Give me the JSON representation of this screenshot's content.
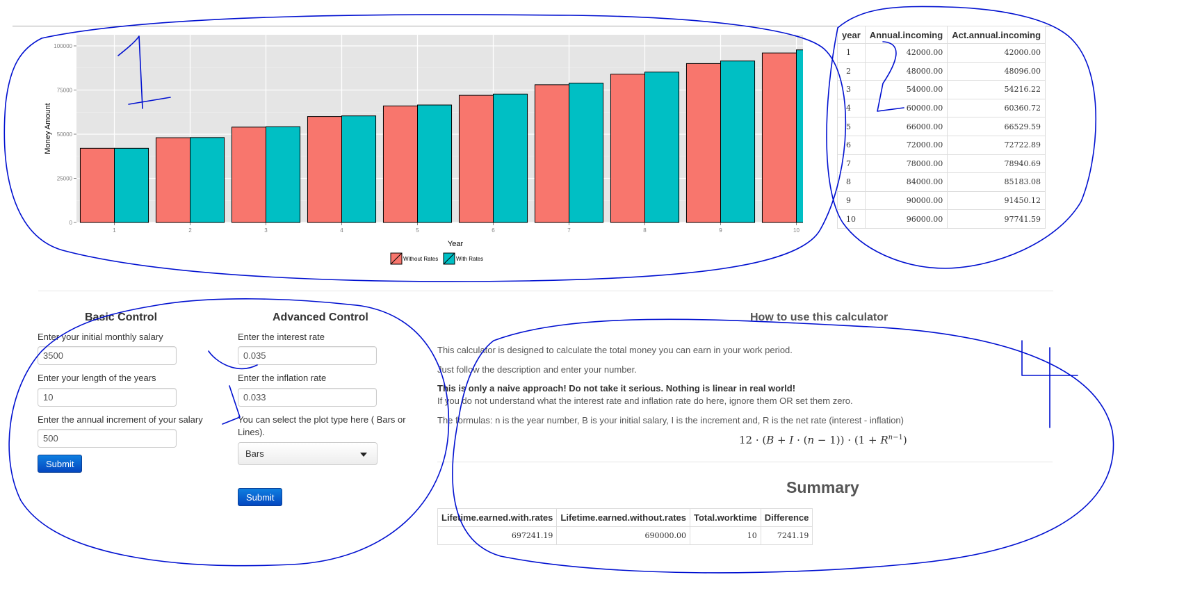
{
  "chart_data": {
    "type": "bar",
    "categories": [
      "1",
      "2",
      "3",
      "4",
      "5",
      "6",
      "7",
      "8",
      "9",
      "10"
    ],
    "series": [
      {
        "name": "Without Rates",
        "color": "#F8766D",
        "values": [
          42000,
          48000,
          54000,
          60000,
          66000,
          72000,
          78000,
          84000,
          90000,
          96000
        ]
      },
      {
        "name": "With Rates",
        "color": "#00BFC4",
        "values": [
          42000,
          48096,
          54216.22,
          60360.72,
          66529.59,
          72722.89,
          78940.69,
          85183.08,
          91450.12,
          97741.59
        ]
      }
    ],
    "xlabel": "Year",
    "ylabel": "Money Amount",
    "ylim": [
      0,
      100000
    ],
    "yticks": [
      "0",
      "25000",
      "50000",
      "75000",
      "100000"
    ],
    "grid": true,
    "legend_position": "bottom"
  },
  "income_table": {
    "headers": [
      "year",
      "Annual.incoming",
      "Act.annual.incoming"
    ],
    "rows": [
      [
        "1",
        "42000.00",
        "42000.00"
      ],
      [
        "2",
        "48000.00",
        "48096.00"
      ],
      [
        "3",
        "54000.00",
        "54216.22"
      ],
      [
        "4",
        "60000.00",
        "60360.72"
      ],
      [
        "5",
        "66000.00",
        "66529.59"
      ],
      [
        "6",
        "72000.00",
        "72722.89"
      ],
      [
        "7",
        "78000.00",
        "78940.69"
      ],
      [
        "8",
        "84000.00",
        "85183.08"
      ],
      [
        "9",
        "90000.00",
        "91450.12"
      ],
      [
        "10",
        "96000.00",
        "97741.59"
      ]
    ]
  },
  "basic": {
    "title": "Basic Control",
    "salary_label": "Enter your initial monthly salary",
    "salary_value": "3500",
    "years_label": "Enter your length of the years",
    "years_value": "10",
    "increment_label": "Enter the annual increment of your salary",
    "increment_value": "500",
    "submit": "Submit"
  },
  "advanced": {
    "title": "Advanced Control",
    "interest_label": "Enter the interest rate",
    "interest_value": "0.035",
    "inflation_label": "Enter the inflation rate",
    "inflation_value": "0.033",
    "plot_label": "You can select the plot type here ( Bars or Lines).",
    "plot_value": "Bars",
    "submit": "Submit"
  },
  "howto": {
    "title": "How to use this calculator",
    "p1": "This calculator is designed to calculate the total money you can earn in your work period.",
    "p2": "Just follow the description and enter your number.",
    "p3": "This is only a naive approach! Do not take it serious. Nothing is linear in real world!",
    "p4": "If you do not understand what the interest rate and inflation rate do here, ignore them OR set them zero.",
    "p5": "The formulas: n is the year number, B is your initial salary, I is the increment and, R is the net rate (interest - inflation)"
  },
  "summary": {
    "title": "Summary",
    "headers": [
      "Lifetime.earned.with.rates",
      "Lifetime.earned.without.rates",
      "Total.worktime",
      "Difference"
    ],
    "values": [
      "697241.19",
      "690000.00",
      "10",
      "7241.19"
    ]
  },
  "annotations": {
    "color": "#0010d0",
    "labels": [
      "1",
      "2",
      "3",
      "4"
    ]
  }
}
